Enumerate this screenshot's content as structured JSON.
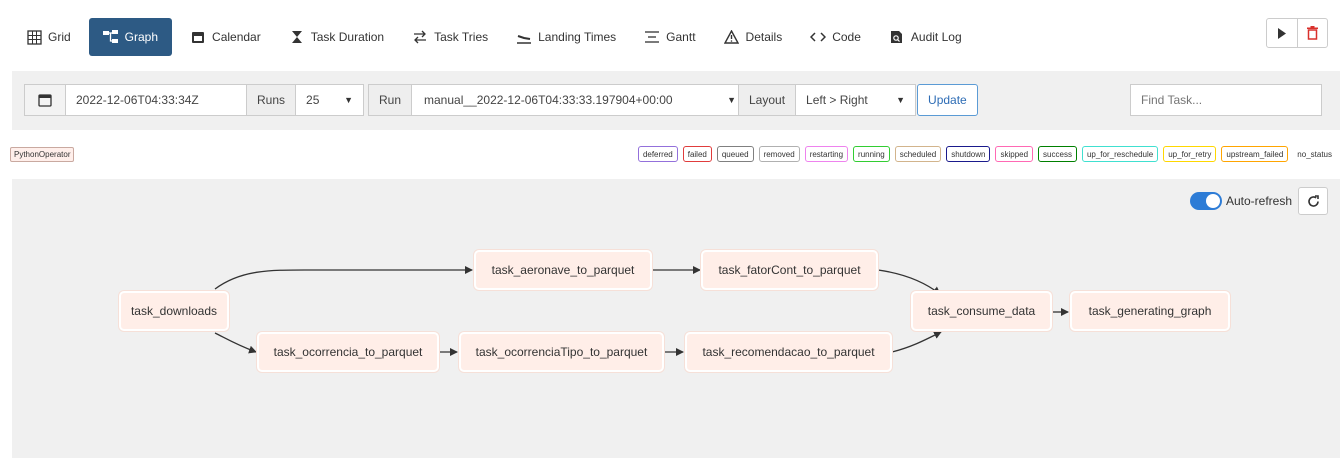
{
  "nav": {
    "items": [
      {
        "label": "Grid",
        "icon": "grid-icon"
      },
      {
        "label": "Graph",
        "icon": "graph-icon",
        "active": true
      },
      {
        "label": "Calendar",
        "icon": "calendar-icon"
      },
      {
        "label": "Task Duration",
        "icon": "hourglass-icon"
      },
      {
        "label": "Task Tries",
        "icon": "tries-icon"
      },
      {
        "label": "Landing Times",
        "icon": "landing-icon"
      },
      {
        "label": "Gantt",
        "icon": "gantt-icon"
      },
      {
        "label": "Details",
        "icon": "warning-icon"
      },
      {
        "label": "Code",
        "icon": "code-icon"
      },
      {
        "label": "Audit Log",
        "icon": "audit-icon"
      }
    ]
  },
  "actions": {
    "play_icon": "play-icon",
    "delete_icon": "trash-icon"
  },
  "filters": {
    "date": "2022-12-06T04:33:34Z",
    "runs_label": "Runs",
    "runs_value": "25",
    "run_label": "Run",
    "run_value": "manual__2022-12-06T04:33:33.197904+00:00",
    "layout_label": "Layout",
    "layout_value": "Left > Right",
    "update_label": "Update",
    "find_placeholder": "Find Task..."
  },
  "operator_tag": "PythonOperator",
  "states": [
    {
      "label": "deferred",
      "color": "#9370db"
    },
    {
      "label": "failed",
      "color": "#e03c3c"
    },
    {
      "label": "queued",
      "color": "#808080"
    },
    {
      "label": "removed",
      "color": "#b0b0b0"
    },
    {
      "label": "restarting",
      "color": "#ee82ee"
    },
    {
      "label": "running",
      "color": "#32cd32"
    },
    {
      "label": "scheduled",
      "color": "#d2b48c"
    },
    {
      "label": "shutdown",
      "color": "#1a1a8c"
    },
    {
      "label": "skipped",
      "color": "#ff69b4"
    },
    {
      "label": "success",
      "color": "#008000"
    },
    {
      "label": "up_for_reschedule",
      "color": "#40e0d0"
    },
    {
      "label": "up_for_retry",
      "color": "#ffd700"
    },
    {
      "label": "upstream_failed",
      "color": "#ffa500"
    },
    {
      "label": "no_status",
      "color": ""
    }
  ],
  "canvas": {
    "autorefresh_label": "Auto-refresh",
    "autorefresh_on": true,
    "refresh_icon": "refresh-icon"
  },
  "tasks": {
    "downloads": "task_downloads",
    "aeronave": "task_aeronave_to_parquet",
    "fatorcont": "task_fatorCont_to_parquet",
    "ocorrencia": "task_ocorrencia_to_parquet",
    "ocorrenciatipo": "task_ocorrenciaTipo_to_parquet",
    "recomendacao": "task_recomendacao_to_parquet",
    "consume": "task_consume_data",
    "graph": "task_generating_graph"
  }
}
